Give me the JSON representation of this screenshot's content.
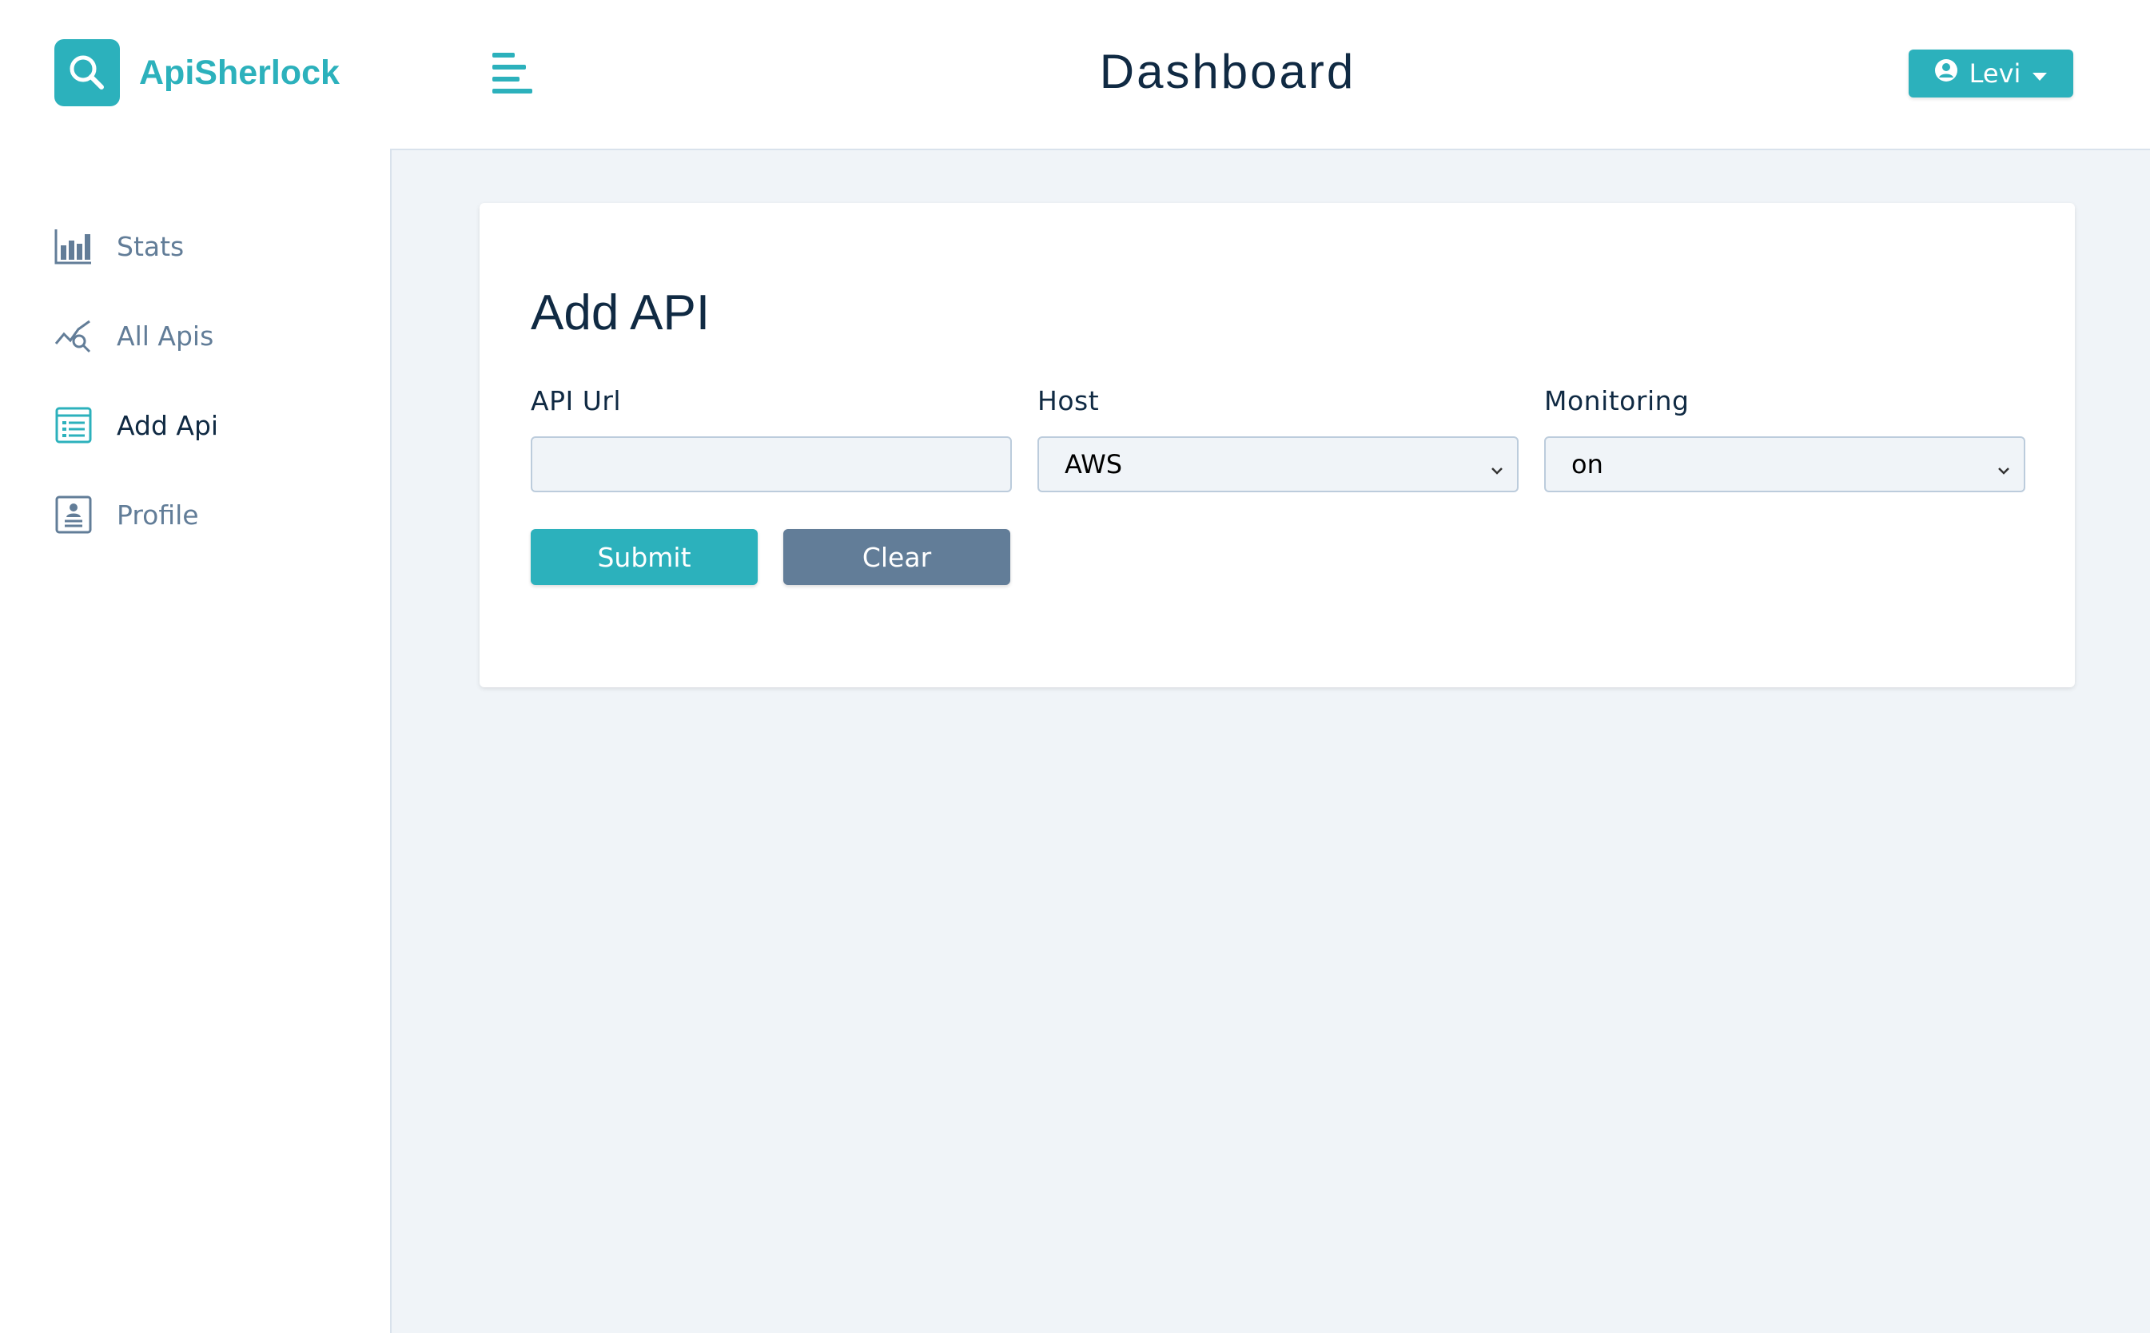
{
  "app": {
    "name": "ApiSherlock",
    "brand_color": "#2cb1bc"
  },
  "header": {
    "title": "Dashboard",
    "menu_icon": "menu-icon",
    "user": {
      "name": "Levi",
      "icon": "user-circle-icon",
      "dropdown_icon": "caret-down-icon"
    }
  },
  "sidebar": {
    "items": [
      {
        "label": "Stats",
        "icon": "bar-chart-icon",
        "active": false
      },
      {
        "label": "All Apis",
        "icon": "chart-search-icon",
        "active": false
      },
      {
        "label": "Add Api",
        "icon": "form-icon",
        "active": true
      },
      {
        "label": "Profile",
        "icon": "profile-card-icon",
        "active": false
      }
    ]
  },
  "form": {
    "title": "Add API",
    "api_url": {
      "label": "API Url",
      "value": "",
      "placeholder": ""
    },
    "host": {
      "label": "Host",
      "selected": "AWS"
    },
    "monitoring": {
      "label": "Monitoring",
      "selected": "on"
    },
    "submit_label": "Submit",
    "clear_label": "Clear"
  }
}
